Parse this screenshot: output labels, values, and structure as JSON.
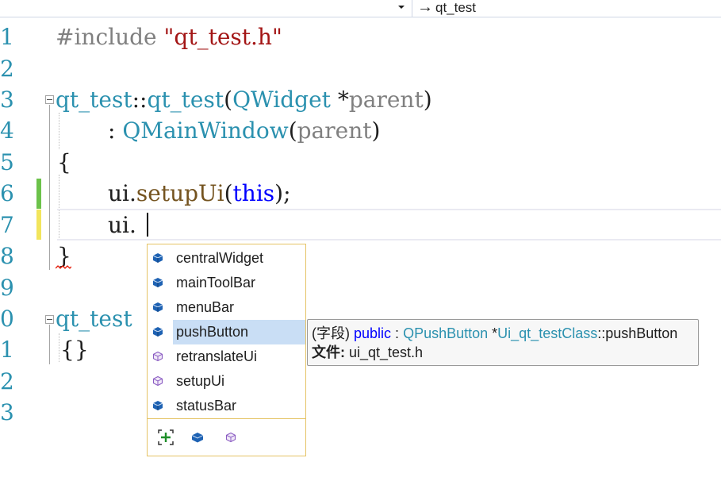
{
  "toolbar": {
    "scope_combo_value": "",
    "member_combo_arrow": "→",
    "member_combo_value": "qt_test"
  },
  "editor": {
    "line_numbers": [
      "1",
      "2",
      "3",
      "4",
      "5",
      "6",
      "7",
      "8",
      "9",
      "0",
      "1",
      "2",
      "3"
    ],
    "line1": {
      "directive": "#include",
      "path": "\"qt_test.h\""
    },
    "line3": {
      "class": "qt_test",
      "scope": "::",
      "ctor": "qt_test",
      "open": "(",
      "ptype": "QWidget",
      "star": " *",
      "pname": "parent",
      "close": ")"
    },
    "line4": {
      "colon": ": ",
      "base": "QMainWindow",
      "open": "(",
      "arg": "parent",
      "close": ")"
    },
    "line5": {
      "brace": "{"
    },
    "line6": {
      "obj": "ui.",
      "method": "setupUi",
      "open": "(",
      "kw": "this",
      "close": ");"
    },
    "line7": {
      "obj": "ui."
    },
    "line8": {
      "brace": "}"
    },
    "line10": {
      "text": "qt_test"
    },
    "line11": {
      "text": "{}"
    }
  },
  "completion": {
    "items": [
      {
        "label": "centralWidget",
        "icon": "field-icon"
      },
      {
        "label": "mainToolBar",
        "icon": "field-icon"
      },
      {
        "label": "menuBar",
        "icon": "field-icon"
      },
      {
        "label": "pushButton",
        "icon": "field-icon",
        "selected": true
      },
      {
        "label": "retranslateUi",
        "icon": "method-icon"
      },
      {
        "label": "setupUi",
        "icon": "method-icon"
      },
      {
        "label": "statusBar",
        "icon": "field-icon"
      }
    ],
    "filters": [
      "expand-filter-icon",
      "field-filter-icon",
      "method-filter-icon"
    ]
  },
  "tooltip": {
    "kind": "(字段)",
    "access": "public",
    "colon": " : ",
    "type": "QPushButton",
    "star": " *",
    "owner": "Ui_qt_testClass",
    "scope": "::",
    "member": "pushButton",
    "file_label": "文件:",
    "file_value": " ui_qt_test.h"
  },
  "colors": {
    "keyword": "#0000ff",
    "type": "#2b91af",
    "string": "#a31515",
    "function": "#74531f",
    "popup_border": "#e5c365",
    "selection": "#c9def5",
    "change_saved": "#6cc24a",
    "change_unsaved": "#f2e55c"
  }
}
